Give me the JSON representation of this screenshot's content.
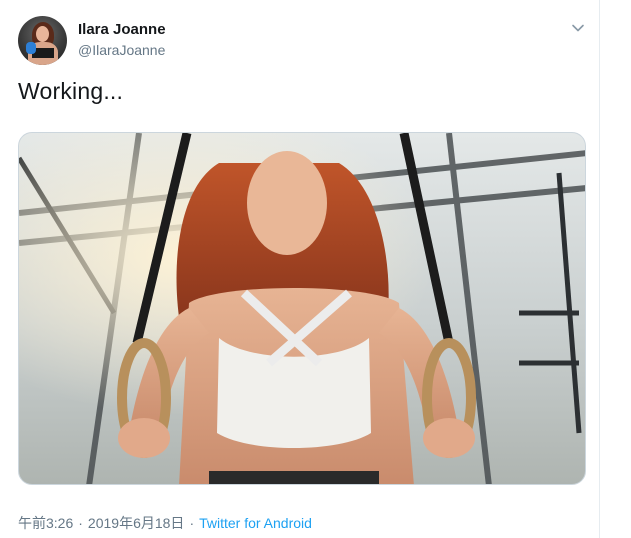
{
  "tweet": {
    "author_name": "Ilara Joanne",
    "author_handle": "@IlaraJoanne",
    "text": "Working...",
    "time": "午前3:26",
    "separator": "·",
    "date": "2019年6月18日",
    "source": "Twitter for Android"
  },
  "icons": {
    "menu": "chevron-down-icon"
  },
  "colors": {
    "text_primary": "#14171a",
    "text_secondary": "#657786",
    "link": "#1da1f2",
    "border": "#e6ecf0"
  }
}
